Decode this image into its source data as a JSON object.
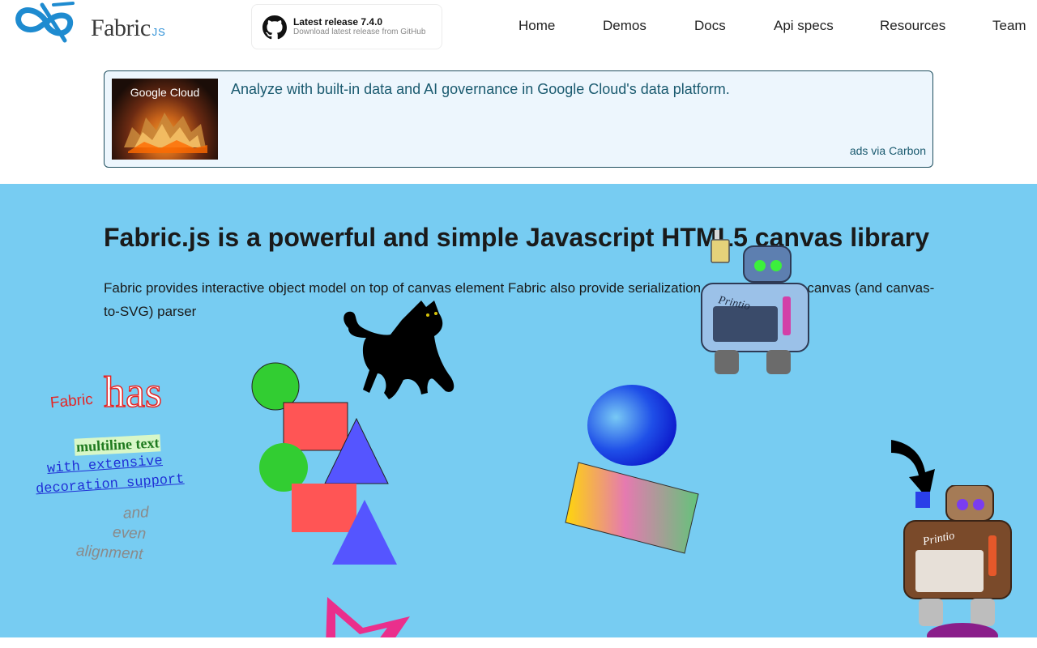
{
  "logo": {
    "text": "Fabric",
    "suffix": "JS"
  },
  "release": {
    "title": "Latest release 7.4.0",
    "subtitle": "Download latest release from GitHub"
  },
  "nav": [
    {
      "label": "Home"
    },
    {
      "label": "Demos"
    },
    {
      "label": "Docs"
    },
    {
      "label": "Api specs"
    },
    {
      "label": "Resources"
    },
    {
      "label": "Team"
    }
  ],
  "ad": {
    "image_label": "Google Cloud",
    "text": "Analyze with built-in data and AI governance in Google Cloud's data platform.",
    "via": "ads via Carbon"
  },
  "hero": {
    "title": "Fabric.js is a powerful and simple Javascript HTML5 canvas library",
    "description": "Fabric provides interactive object model on top of canvas element Fabric also provide serialization and has SVG-to-canvas (and canvas-to-SVG) parser"
  },
  "demo_text": {
    "fabric": "Fabric",
    "has": "has",
    "multiline": "multiline text",
    "extensive": "with extensive",
    "decoration": "decoration support",
    "and": "and",
    "even": "even",
    "alignment": "alignment",
    "robot_label": "Printio"
  },
  "colors": {
    "hero_bg": "#77ccf2",
    "circle_green": "#32cd32",
    "rect_red": "#ff5555",
    "triangle_blue": "#5555ff",
    "text_red": "#e52525",
    "text_blue": "#1f2fd6",
    "text_green": "#1f7a1f",
    "text_gray": "#8a8a8a"
  }
}
